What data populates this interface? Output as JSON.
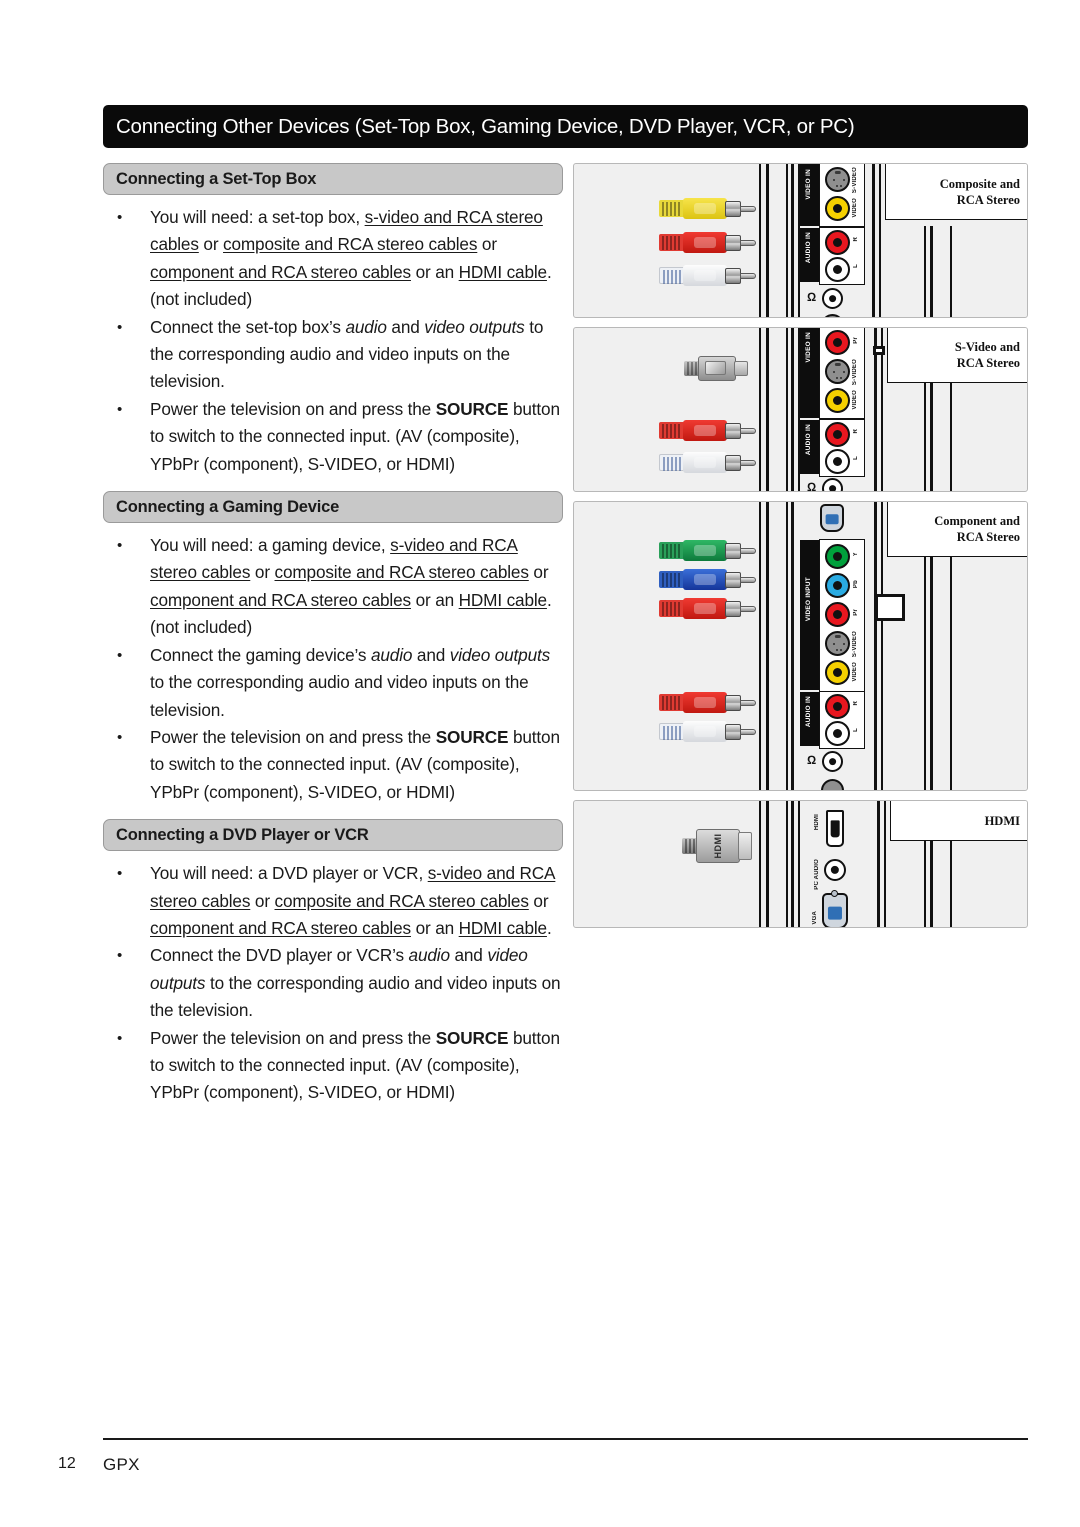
{
  "document": {
    "title_bar": "Connecting Other Devices (Set-Top Box, Gaming Device, DVD Player, VCR, or PC)",
    "footer": {
      "page_number": "12",
      "brand": "GPX"
    }
  },
  "sections": [
    {
      "heading": "Connecting a Set-Top Box",
      "bullets": [
        {
          "parts": [
            {
              "text": "You will need: a set-top box, ",
              "style": "normal"
            },
            {
              "text": "s-video and RCA stereo cables",
              "style": "underline"
            },
            {
              "text": " or ",
              "style": "normal"
            },
            {
              "text": "composite and RCA stereo cables",
              "style": "underline"
            },
            {
              "text": " or ",
              "style": "normal"
            },
            {
              "text": "component and RCA stereo cables",
              "style": "underline"
            },
            {
              "text": " or an ",
              "style": "normal"
            },
            {
              "text": "HDMI cable",
              "style": "underline"
            },
            {
              "text": ". (not included)",
              "style": "normal"
            }
          ]
        },
        {
          "parts": [
            {
              "text": "Connect the set-top box’s ",
              "style": "normal"
            },
            {
              "text": "audio",
              "style": "italic"
            },
            {
              "text": " and ",
              "style": "normal"
            },
            {
              "text": "video outputs",
              "style": "italic"
            },
            {
              "text": " to the corresponding audio and video inputs on the television.",
              "style": "normal"
            }
          ]
        },
        {
          "parts": [
            {
              "text": "Power the television on and press the ",
              "style": "normal"
            },
            {
              "text": "SOURCE",
              "style": "bold"
            },
            {
              "text": " button to switch to the connected input. (AV (composite), YPbPr (component), S-VIDEO, or HDMI)",
              "style": "normal"
            }
          ]
        }
      ]
    },
    {
      "heading": "Connecting a Gaming Device",
      "bullets": [
        {
          "parts": [
            {
              "text": "You will need: a gaming device, ",
              "style": "normal"
            },
            {
              "text": "s-video and RCA stereo cables",
              "style": "underline"
            },
            {
              "text": " or ",
              "style": "normal"
            },
            {
              "text": "composite and RCA stereo cables",
              "style": "underline"
            },
            {
              "text": " or ",
              "style": "normal"
            },
            {
              "text": "component and RCA stereo cables",
              "style": "underline"
            },
            {
              "text": " or an ",
              "style": "normal"
            },
            {
              "text": "HDMI cable",
              "style": "underline"
            },
            {
              "text": ". (not included)",
              "style": "normal"
            }
          ]
        },
        {
          "parts": [
            {
              "text": "Connect the gaming device’s ",
              "style": "normal"
            },
            {
              "text": "audio",
              "style": "italic"
            },
            {
              "text": " and ",
              "style": "normal"
            },
            {
              "text": "video outputs",
              "style": "italic"
            },
            {
              "text": " to the corresponding audio and video inputs on the television.",
              "style": "normal"
            }
          ]
        },
        {
          "parts": [
            {
              "text": "Power the television on and press the ",
              "style": "normal"
            },
            {
              "text": "SOURCE",
              "style": "bold"
            },
            {
              "text": " button to switch to the connected input. (AV (composite), YPbPr (component), S-VIDEO, or HDMI)",
              "style": "normal"
            }
          ]
        }
      ]
    },
    {
      "heading": "Connecting a DVD Player or VCR",
      "bullets": [
        {
          "parts": [
            {
              "text": "You will need: a DVD player or VCR, ",
              "style": "normal"
            },
            {
              "text": "s-video and RCA stereo cables",
              "style": "underline"
            },
            {
              "text": " or ",
              "style": "normal"
            },
            {
              "text": "composite and RCA stereo cables",
              "style": "underline"
            },
            {
              "text": " or ",
              "style": "normal"
            },
            {
              "text": "component and RCA stereo cables",
              "style": "underline"
            },
            {
              "text": " or an ",
              "style": "normal"
            },
            {
              "text": "HDMI cable",
              "style": "underline"
            },
            {
              "text": ".",
              "style": "normal"
            }
          ]
        },
        {
          "parts": [
            {
              "text": "Connect the DVD player or VCR’s ",
              "style": "normal"
            },
            {
              "text": "audio",
              "style": "italic"
            },
            {
              "text": " and ",
              "style": "normal"
            },
            {
              "text": "video outputs",
              "style": "italic"
            },
            {
              "text": " to the corresponding audio and video inputs on the television.",
              "style": "normal"
            }
          ]
        },
        {
          "parts": [
            {
              "text": "Power the television on and press the ",
              "style": "normal"
            },
            {
              "text": "SOURCE",
              "style": "bold"
            },
            {
              "text": " button to switch to the connected input. (AV (composite), YPbPr (component), S-VIDEO, or HDMI)",
              "style": "normal"
            }
          ]
        }
      ]
    }
  ],
  "diagrams": [
    {
      "callout": [
        "Composite and",
        "RCA Stereo"
      ],
      "cables": [
        {
          "type": "rca-plug",
          "color": "yellow",
          "color_hex": "#f5d000"
        },
        {
          "type": "rca-plug",
          "color": "red",
          "color_hex": "#e8171f"
        },
        {
          "type": "rca-plug",
          "color": "white",
          "color_hex": "#ffffff"
        }
      ],
      "port_groups": [
        {
          "label": "VIDEO IN",
          "ports": [
            {
              "label": "S-VIDEO",
              "type": "s-video",
              "color_hex": "#8f8f8f"
            },
            {
              "label": "VIDEO",
              "type": "rca",
              "color_hex": "#f5d000"
            }
          ]
        },
        {
          "label": "AUDIO IN",
          "ports": [
            {
              "label": "R",
              "type": "rca",
              "color_hex": "#e8171f"
            },
            {
              "label": "L",
              "type": "rca",
              "color_hex": "#ffffff"
            }
          ]
        }
      ],
      "extra_ports": [
        {
          "label": "headphone",
          "type": "headphone-jack"
        }
      ]
    },
    {
      "callout": [
        "S-Video and",
        "RCA Stereo"
      ],
      "cables": [
        {
          "type": "s-video-plug",
          "color": "gray",
          "color_hex": "#a8a8a8"
        },
        {
          "type": "rca-plug",
          "color": "red",
          "color_hex": "#e8171f"
        },
        {
          "type": "rca-plug",
          "color": "white",
          "color_hex": "#ffffff"
        }
      ],
      "port_groups": [
        {
          "label": "VIDEO IN",
          "ports": [
            {
              "label": "Pr",
              "type": "rca",
              "color_hex": "#e8171f"
            },
            {
              "label": "S-VIDEO",
              "type": "s-video",
              "color_hex": "#8f8f8f"
            },
            {
              "label": "VIDEO",
              "type": "rca",
              "color_hex": "#f5d000"
            }
          ]
        },
        {
          "label": "AUDIO IN",
          "ports": [
            {
              "label": "R",
              "type": "rca",
              "color_hex": "#e8171f"
            },
            {
              "label": "L",
              "type": "rca",
              "color_hex": "#ffffff"
            }
          ]
        }
      ],
      "extra_ports": [
        {
          "label": "headphone",
          "type": "headphone-jack"
        }
      ]
    },
    {
      "callout": [
        "Component and",
        "RCA Stereo"
      ],
      "cables": [
        {
          "type": "rca-plug",
          "color": "green",
          "color_hex": "#00a03c"
        },
        {
          "type": "rca-plug",
          "color": "blue",
          "color_hex": "#2aabe2"
        },
        {
          "type": "rca-plug",
          "color": "red",
          "color_hex": "#e8171f"
        },
        {
          "type": "rca-plug",
          "color": "red",
          "color_hex": "#e8171f"
        },
        {
          "type": "rca-plug",
          "color": "white",
          "color_hex": "#ffffff"
        }
      ],
      "port_groups": [
        {
          "label": "VIDEO INPUT",
          "ports": [
            {
              "label": "Y",
              "type": "rca",
              "color_hex": "#00a03c"
            },
            {
              "label": "Pb",
              "type": "rca",
              "color_hex": "#2aabe2"
            },
            {
              "label": "Pr",
              "type": "rca",
              "color_hex": "#e8171f"
            },
            {
              "label": "S-VIDEO",
              "type": "s-video",
              "color_hex": "#8f8f8f"
            },
            {
              "label": "VIDEO",
              "type": "rca",
              "color_hex": "#f5d000"
            }
          ]
        },
        {
          "label": "AUDIO IN",
          "ports": [
            {
              "label": "R",
              "type": "rca",
              "color_hex": "#e8171f"
            },
            {
              "label": "L",
              "type": "rca",
              "color_hex": "#ffffff"
            }
          ]
        }
      ],
      "extra_ports": [
        {
          "label": "VGA",
          "type": "vga-socket"
        },
        {
          "label": "headphone",
          "type": "headphone-jack"
        }
      ]
    },
    {
      "callout": [
        "HDMI"
      ],
      "cables": [
        {
          "type": "hdmi-plug",
          "color": "gray",
          "color_hex": "#b0b0b0",
          "label": "HDMI"
        }
      ],
      "port_groups": [],
      "extra_ports": [
        {
          "label": "HDMI",
          "type": "hdmi-socket"
        },
        {
          "label": "PC AUDIO",
          "type": "audio-jack"
        },
        {
          "label": "VGA",
          "type": "vga-socket"
        }
      ]
    }
  ]
}
